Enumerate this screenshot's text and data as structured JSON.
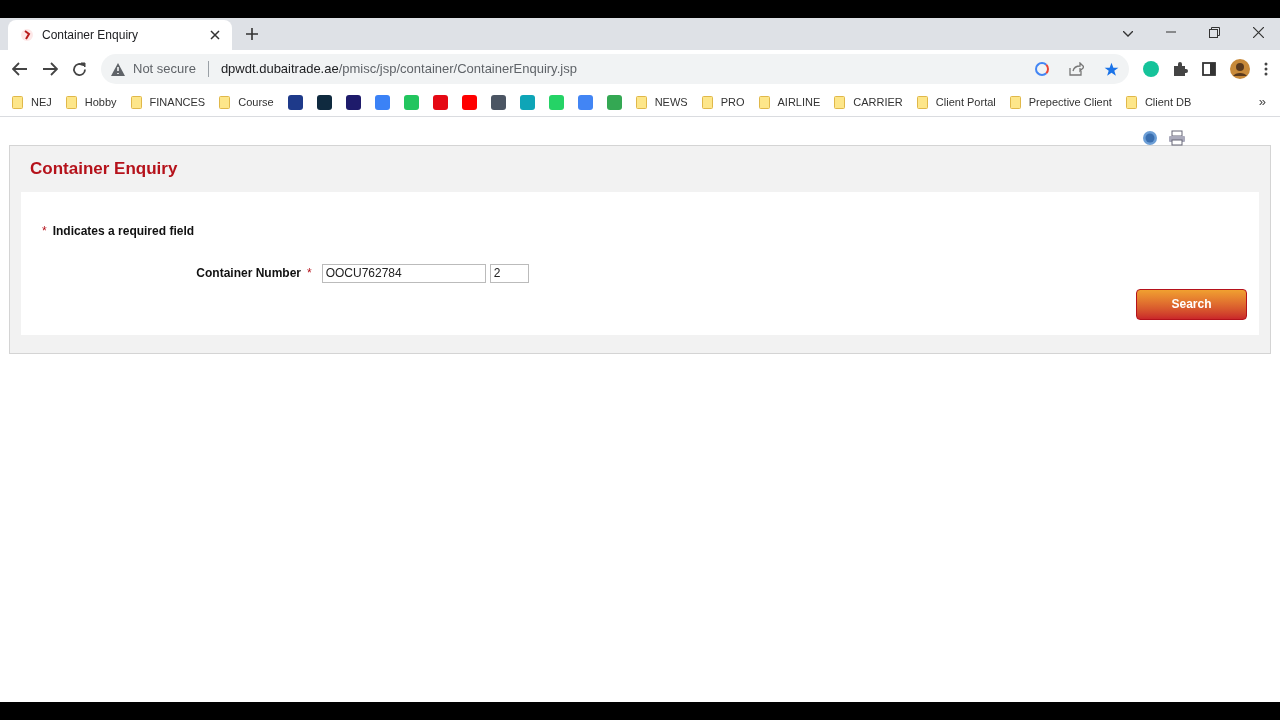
{
  "browser": {
    "tab_title": "Container Enquiry",
    "security_label": "Not secure",
    "url_host": "dpwdt.dubaitrade.ae",
    "url_path": "/pmisc/jsp/container/ContainerEnquiry.jsp"
  },
  "bookmarks": [
    {
      "kind": "folder",
      "label": "NEJ"
    },
    {
      "kind": "folder",
      "label": "Hobby"
    },
    {
      "kind": "folder",
      "label": "FINANCES"
    },
    {
      "kind": "folder",
      "label": "Course"
    },
    {
      "kind": "site",
      "color": "#1e3a8a"
    },
    {
      "kind": "site",
      "color": "#0f2a3f"
    },
    {
      "kind": "site",
      "color": "#1e1b6b"
    },
    {
      "kind": "site",
      "color": "#3b82f6"
    },
    {
      "kind": "site",
      "color": "#22c55e"
    },
    {
      "kind": "site",
      "color": "#e50914"
    },
    {
      "kind": "site",
      "color": "#ff0000"
    },
    {
      "kind": "site",
      "color": "#4b5563"
    },
    {
      "kind": "site",
      "color": "#0ea5b7"
    },
    {
      "kind": "site",
      "color": "#25d366"
    },
    {
      "kind": "site",
      "color": "#4285f4"
    },
    {
      "kind": "site",
      "color": "#34a853"
    },
    {
      "kind": "folder",
      "label": "NEWS"
    },
    {
      "kind": "folder",
      "label": "PRO"
    },
    {
      "kind": "folder",
      "label": "AIRLINE"
    },
    {
      "kind": "folder",
      "label": "CARRIER"
    },
    {
      "kind": "folder",
      "label": "Client Portal"
    },
    {
      "kind": "folder",
      "label": "Prepective Client"
    },
    {
      "kind": "folder",
      "label": "Client DB"
    }
  ],
  "bookmarks_overflow": "»",
  "page": {
    "title": "Container Enquiry",
    "required_mark": "*",
    "required_note": "Indicates a required field",
    "fields": [
      {
        "label": "Container Number",
        "required_mark": "*",
        "value": "OOCU762784",
        "check_digit": "2"
      }
    ],
    "search_button": "Search"
  }
}
